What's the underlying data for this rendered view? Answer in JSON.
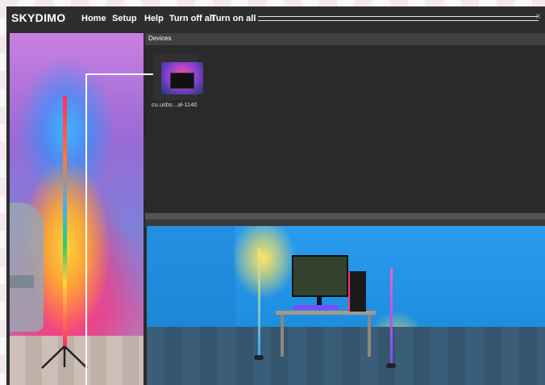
{
  "app": {
    "logo": "SKYDIMO"
  },
  "menu": {
    "home": "Home",
    "setup": "Setup",
    "help": "Help",
    "turn_off_all": "Turn off all",
    "turn_on_all": "Turn on all"
  },
  "window": {
    "close_glyph": "×"
  },
  "devices": {
    "title": "Devices",
    "items": [
      {
        "name": "cu.usbs...al-1140",
        "icon": "monitor-led-icon"
      }
    ]
  },
  "colors": {
    "window_bg": "#2b2b2b",
    "panel_header": "#404040",
    "text": "#ffffff"
  }
}
